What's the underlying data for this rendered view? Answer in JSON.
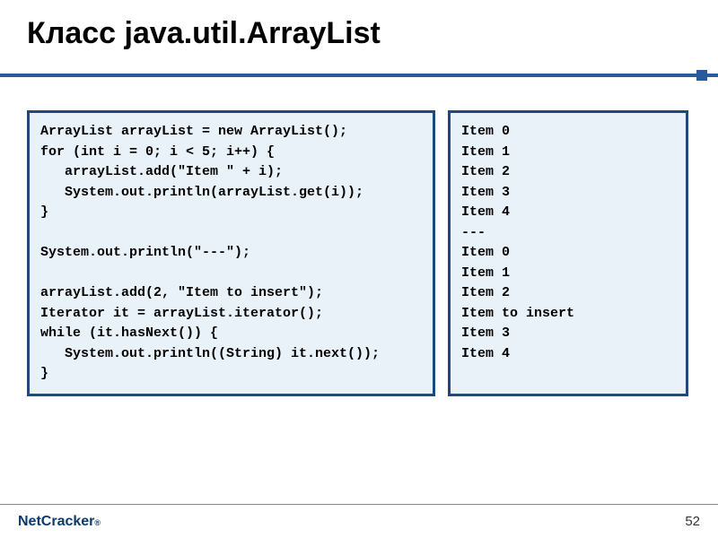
{
  "title": "Класс java.util.ArrayList",
  "code_left": "ArrayList arrayList = new ArrayList();\nfor (int i = 0; i < 5; i++) {\n   arrayList.add(\"Item \" + i);\n   System.out.println(arrayList.get(i));\n}\n\nSystem.out.println(\"---\");\n\narrayList.add(2, \"Item to insert\");\nIterator it = arrayList.iterator();\nwhile (it.hasNext()) {\n   System.out.println((String) it.next());\n}",
  "code_right": "Item 0\nItem 1\nItem 2\nItem 3\nItem 4\n---\nItem 0\nItem 1\nItem 2\nItem to insert\nItem 3\nItem 4",
  "footer": {
    "logo_part1": "Net",
    "logo_part2": "Cracker",
    "logo_reg": "®"
  },
  "page_number": "52"
}
